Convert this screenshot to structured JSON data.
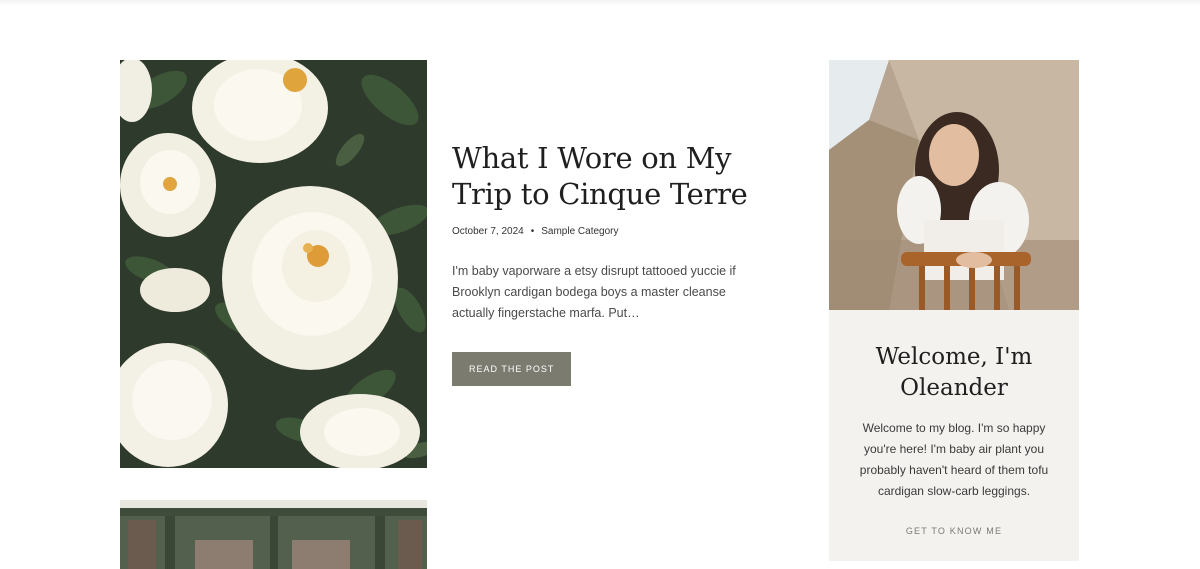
{
  "post": {
    "title": "What I Wore on My Trip to Cinque Terre",
    "date": "October 7, 2024",
    "separator": "•",
    "category": "Sample Category",
    "excerpt": "I'm baby vaporware a etsy disrupt tattooed yuccie if Brooklyn cardigan bodega boys a master cleanse actually fingerstache marfa. Put…",
    "button_label": "READ THE POST",
    "button_color": "#7b7b6f"
  },
  "sidebar": {
    "title": "Welcome, I'm Oleander",
    "text": "Welcome to my blog. I'm so happy you're here! I'm baby air plant you probably haven't heard of them tofu cardigan slow-carb leggings.",
    "link_label": "GET TO KNOW ME",
    "background": "#f4f2ef"
  }
}
